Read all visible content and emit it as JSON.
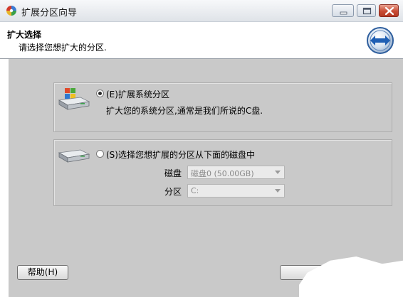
{
  "window": {
    "title": "扩展分区向导"
  },
  "header": {
    "title": "扩大选择",
    "subtitle": "请选择您想扩大的分区."
  },
  "options": [
    {
      "label": "(E)扩展系统分区",
      "description": "扩大您的系统分区,通常是我们所说的C盘.",
      "selected": true
    },
    {
      "label": "(S)选择您想扩展的分区从下面的磁盘中",
      "selected": false,
      "fields": {
        "disk_label": "磁盘",
        "disk_value": "磁盘0 (50.00GB)",
        "partition_label": "分区",
        "partition_value": "C:"
      }
    }
  ],
  "footer": {
    "help_label": "帮助(H)"
  },
  "icons": {
    "app": "partition-wizard-icon",
    "header": "expand-arrows-icon",
    "system_disk": "system-disk-icon",
    "disk": "disk-icon"
  },
  "colors": {
    "panel_bg": "#c9c9c9",
    "header_icon_blue": "#1f5fb4",
    "close_red": "#c84b33"
  }
}
